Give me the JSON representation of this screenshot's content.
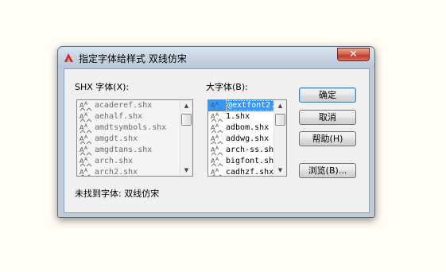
{
  "dialog": {
    "title": "指定字体给样式 双线仿宋",
    "close_glyph": "✕",
    "app_icon": "autocad-icon"
  },
  "shx_list": {
    "label": "SHX 字体(X):",
    "items": [
      "acaderef.shx",
      "aehalf.shx",
      "amdtsymbols.shx",
      "amgdt.shx",
      "amgdtans.shx",
      "arch.shx",
      "arch2.shx"
    ],
    "enabled": false
  },
  "bigfont_list": {
    "label": "大字体(B):",
    "items": [
      "@extfont2.s",
      "1.shx",
      "adbom.shx",
      "addwg.shx",
      "arch-ss.shx",
      "bigfont.shx",
      "cadhzf.shx"
    ],
    "selected_index": 0
  },
  "buttons": {
    "ok": "确定",
    "cancel": "取消",
    "help": "帮助(H)",
    "browse": "浏览(B)..."
  },
  "status": {
    "missing_font_text": "未找到字体: 双线仿宋"
  },
  "icons": {
    "list_item_icon": "shx-font-icon",
    "scroll_up": "▲",
    "scroll_down": "▼"
  },
  "colors": {
    "selection": "#3399ff",
    "close_button": "#c0392b",
    "frame": "#bfcbd9"
  }
}
